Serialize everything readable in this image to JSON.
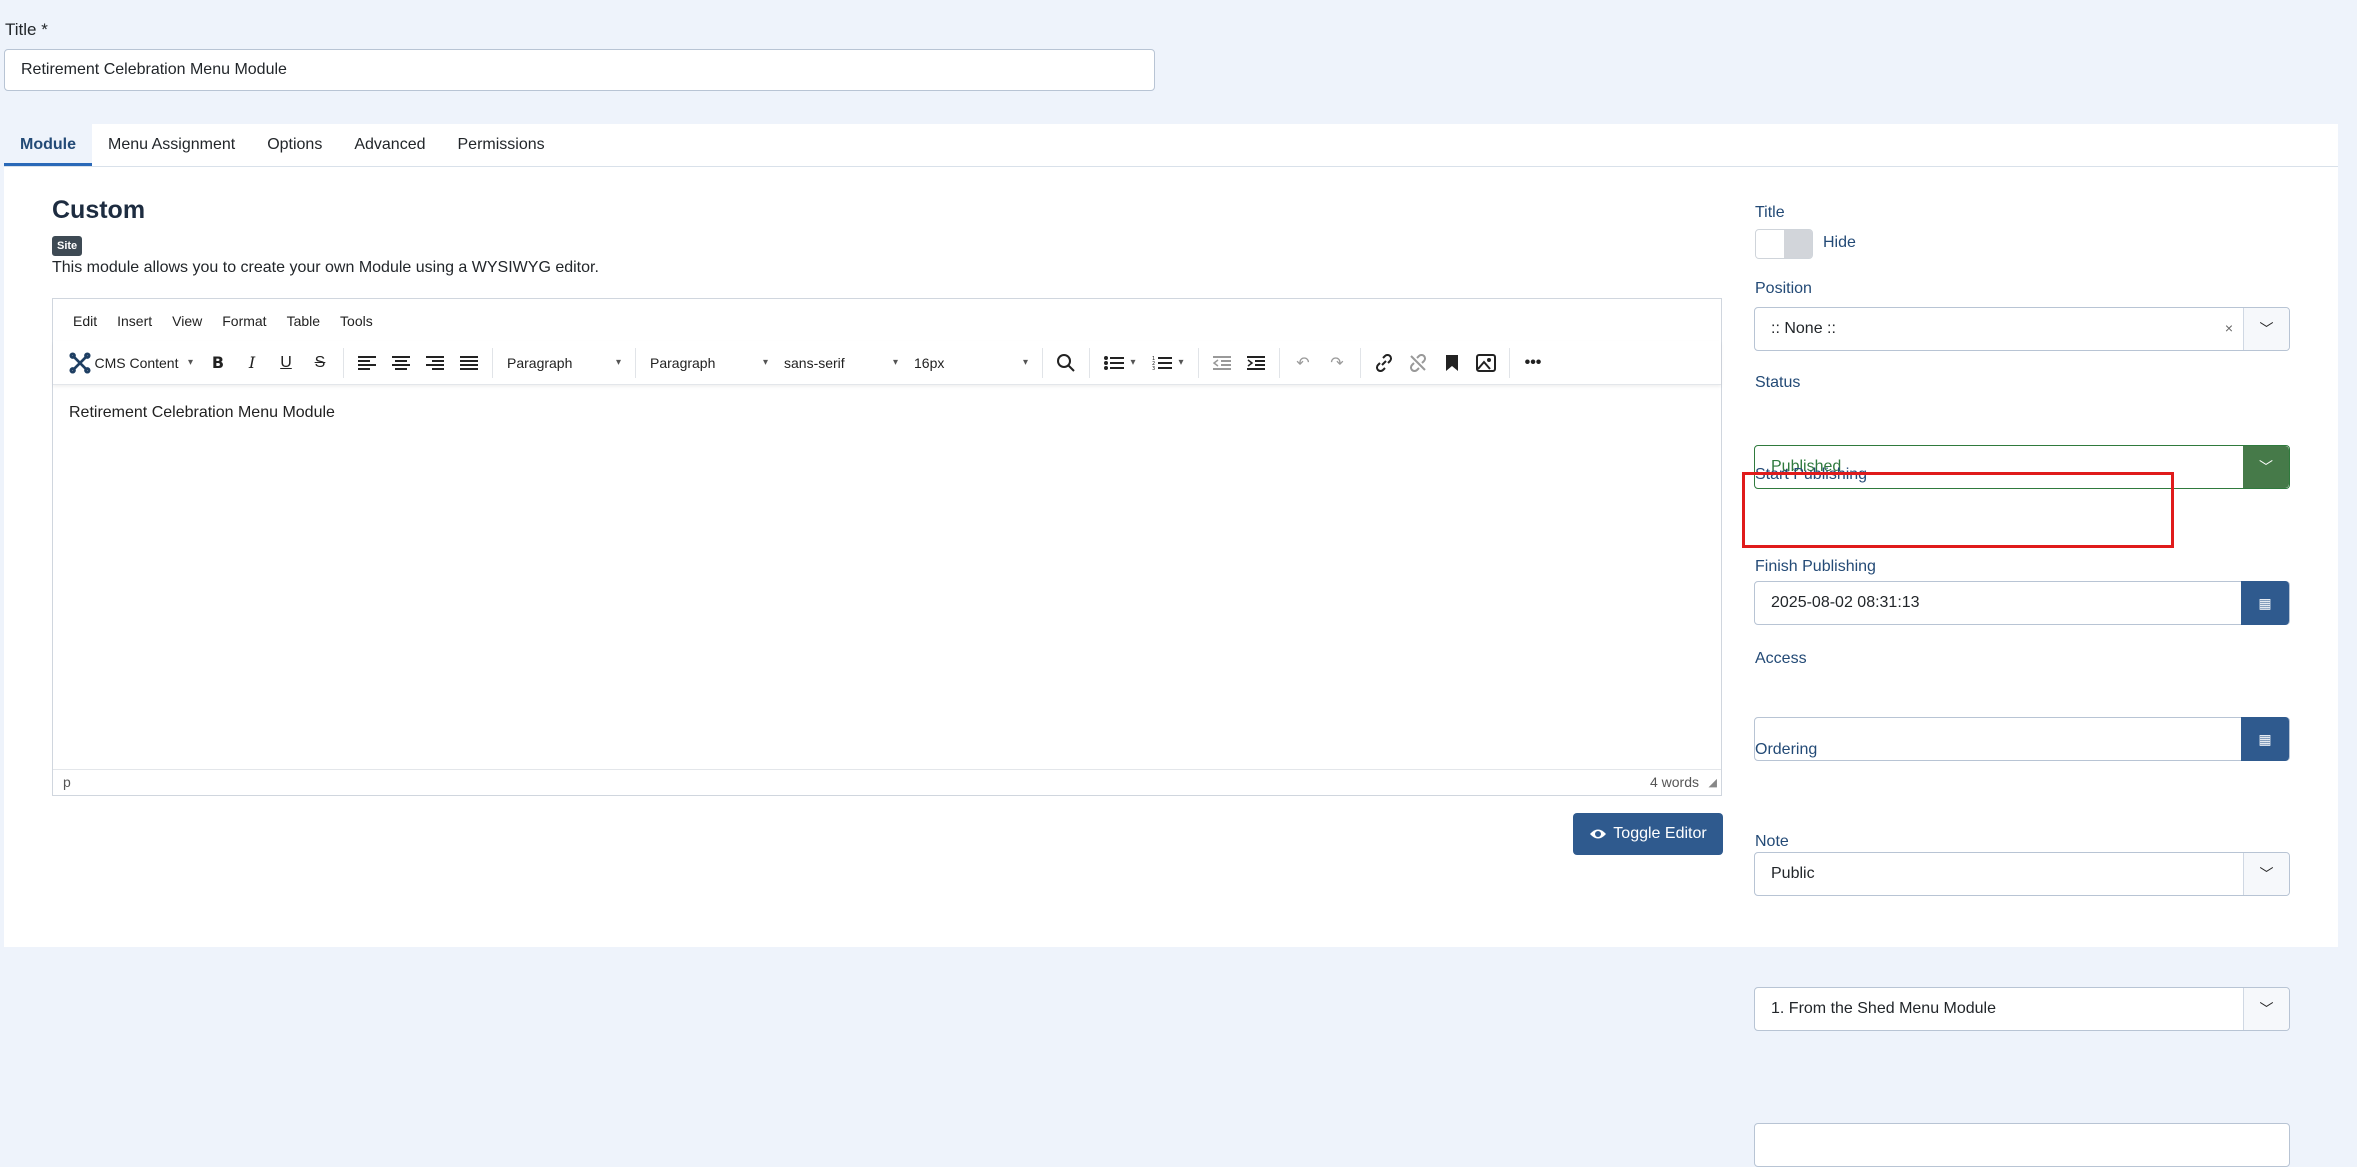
{
  "title_field": {
    "label": "Title *",
    "value": "Retirement Celebration Menu Module"
  },
  "tabs": [
    {
      "label": "Module",
      "active": true
    },
    {
      "label": "Menu Assignment",
      "active": false
    },
    {
      "label": "Options",
      "active": false
    },
    {
      "label": "Advanced",
      "active": false
    },
    {
      "label": "Permissions",
      "active": false
    }
  ],
  "module": {
    "heading": "Custom",
    "badge": "Site",
    "description": "This module allows you to create your own Module using a WYSIWYG editor."
  },
  "editor": {
    "menu": [
      "Edit",
      "Insert",
      "View",
      "Format",
      "Table",
      "Tools"
    ],
    "cms_content": "CMS Content",
    "block_format": "Paragraph",
    "paragraph_format": "Paragraph",
    "font_family": "sans-serif",
    "font_size": "16px",
    "content": "Retirement Celebration Menu Module",
    "path": "p",
    "word_count": "4 words"
  },
  "toggle_editor_label": "Toggle Editor",
  "sidebar": {
    "title": {
      "label": "Title",
      "toggle_label": "Hide"
    },
    "position": {
      "label": "Position",
      "value": ":: None ::"
    },
    "status": {
      "label": "Status",
      "value": "Published",
      "color": "#2f7a3d"
    },
    "start_publishing": {
      "label": "Start Publishing",
      "value": "2025-08-02 08:31:13"
    },
    "finish_publishing": {
      "label": "Finish Publishing",
      "value": ""
    },
    "access": {
      "label": "Access",
      "value": "Public"
    },
    "ordering": {
      "label": "Ordering",
      "value": "1. From the Shed Menu Module"
    },
    "note": {
      "label": "Note",
      "value": ""
    }
  },
  "colors": {
    "primary": "#2f5a8e",
    "highlight": "#e01b1b",
    "page_bg": "#eef3fb"
  }
}
